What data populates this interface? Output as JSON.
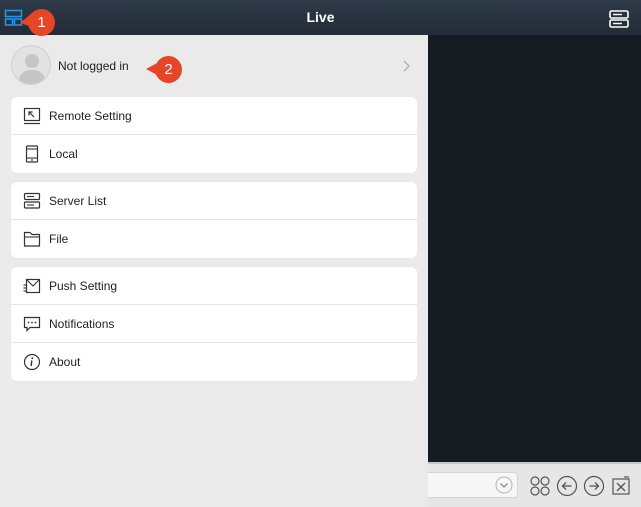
{
  "header": {
    "title": "Live"
  },
  "profile": {
    "status_text": "Not logged in"
  },
  "menu_groups": [
    {
      "items": [
        {
          "label": "Remote Setting",
          "icon": "remote-setting-icon"
        },
        {
          "label": "Local",
          "icon": "local-device-icon"
        }
      ]
    },
    {
      "items": [
        {
          "label": "Server List",
          "icon": "server-list-icon"
        },
        {
          "label": "File",
          "icon": "folder-icon"
        }
      ]
    },
    {
      "items": [
        {
          "label": "Push Setting",
          "icon": "push-setting-icon"
        },
        {
          "label": "Notifications",
          "icon": "notification-icon"
        },
        {
          "label": "About",
          "icon": "info-icon"
        }
      ]
    }
  ],
  "callouts": [
    {
      "number": "1"
    },
    {
      "number": "2"
    }
  ],
  "colors": {
    "accent": "#1e9bf0",
    "callout": "#e64528",
    "titlebar": "#2f3a49"
  }
}
